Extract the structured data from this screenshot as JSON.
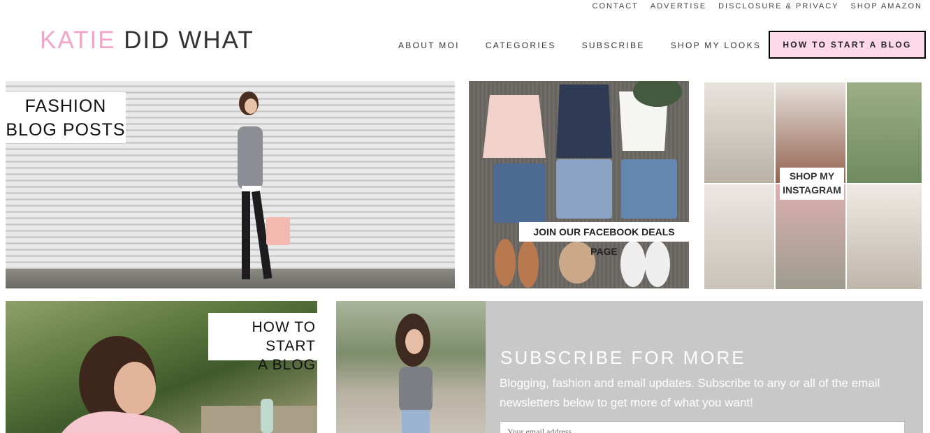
{
  "topbar": {
    "links": [
      "CONTACT",
      "ADVERTISE",
      "DISCLOSURE & PRIVACY",
      "SHOP AMAZON"
    ]
  },
  "logo": {
    "part1": "KATIE",
    "part2": "DID WHAT",
    "pink": "#f2a5c8"
  },
  "nav": {
    "items": [
      "ABOUT MOI",
      "CATEGORIES",
      "SUBSCRIBE",
      "SHOP MY LOOKS"
    ],
    "cta": "HOW TO START A BLOG",
    "cta_color": "#fdd8e8"
  },
  "tiles": {
    "fashion": {
      "line1": "FASHION",
      "line2": "BLOG POSTS"
    },
    "facebook": {
      "label": "JOIN OUR FACEBOOK DEALS PAGE"
    },
    "instagram": {
      "line1": "SHOP MY",
      "line2": "INSTAGRAM"
    },
    "howto": {
      "line1": "HOW TO START",
      "line2": "A BLOG"
    }
  },
  "subscribe": {
    "title": "SUBSCRIBE FOR MORE",
    "text": "Blogging, fashion and email updates. Subscribe to any or all of the email newsletters below to get more of what you want!",
    "email_placeholder": "Your email address",
    "panel_color": "#c8c8c8"
  }
}
